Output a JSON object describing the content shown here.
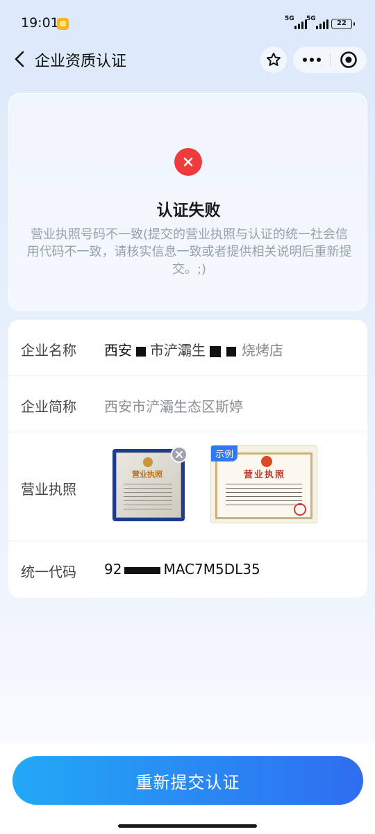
{
  "status": {
    "time": "19:01",
    "net1": "5G",
    "net2": "5G",
    "battery": "22"
  },
  "nav": {
    "title": "企业资质认证"
  },
  "result": {
    "title": "认证失败",
    "message": "营业执照号码不一致(提交的营业执照与认证的统一社会信用代码不一致，请核实信息一致或者提供相关说明后重新提交。;)"
  },
  "form": {
    "company_name": {
      "label": "企业名称",
      "value_start": "西安",
      "value_mid": "市浐灞生",
      "value_end": "烧烤店"
    },
    "short_name": {
      "label": "企业简称",
      "value": "西安市浐灞生态区斯婷"
    },
    "license": {
      "label": "营业执照",
      "photo_title": "营业执照",
      "sample_badge": "示例",
      "sample_title": "营业执照"
    },
    "credit_code": {
      "label": "统一代码",
      "value_start": "92",
      "value_mid": "MAC",
      "value_end": "7M5DL35"
    }
  },
  "actions": {
    "resubmit_label": "重新提交认证"
  },
  "colors": {
    "fail": "#ef3b3b",
    "primary_start": "#22a9f6",
    "primary_end": "#2f6df0",
    "example_badge": "#2f79f6"
  }
}
